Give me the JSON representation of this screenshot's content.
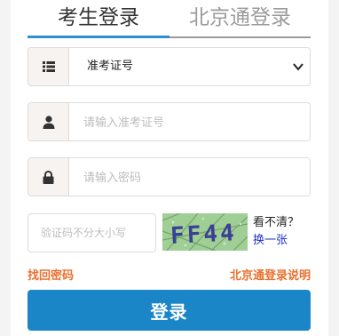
{
  "tabs": {
    "candidate_login": "考生登录",
    "beijing_tong_login": "北京通登录"
  },
  "form": {
    "id_type": {
      "icon": "list-icon",
      "selected": "准考证号"
    },
    "username": {
      "icon": "user-icon",
      "placeholder": "请输入准考证号"
    },
    "password": {
      "icon": "lock-icon",
      "placeholder": "请输入密码"
    },
    "captcha": {
      "placeholder": "验证码不分大小写",
      "image_text": "FF44",
      "unclear_label": "看不清？",
      "refresh_label": "换一张"
    }
  },
  "links": {
    "forgot_password": "找回密码",
    "beijing_tong_help": "北京通登录说明"
  },
  "actions": {
    "login": "登录"
  },
  "colors": {
    "accent": "#2e8fd0",
    "button": "#1b86c7",
    "link_orange": "#e8702f",
    "refresh_link": "#1a33c7"
  }
}
